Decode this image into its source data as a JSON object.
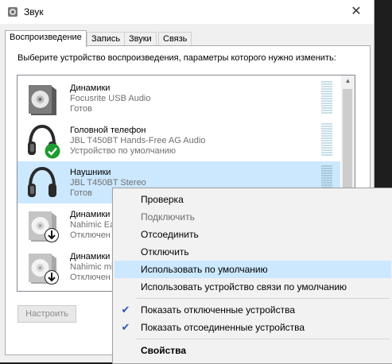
{
  "window": {
    "title": "Звук",
    "close_glyph": "✕"
  },
  "tabs": [
    {
      "label": "Воспроизведение",
      "active": true
    },
    {
      "label": "Запись"
    },
    {
      "label": "Звуки"
    },
    {
      "label": "Связь"
    }
  ],
  "instruction": "Выберите устройство воспроизведения, параметры которого нужно изменить:",
  "devices": [
    {
      "name": "Динамики",
      "driver": "Focusrite USB Audio",
      "status": "Готов",
      "icon": "speaker-icon"
    },
    {
      "name": "Головной телефон",
      "driver": "JBL T450BT Hands-Free AG Audio",
      "status": "Устройство по умолчанию",
      "icon": "headphones-icon",
      "badge": "default-check-icon"
    },
    {
      "name": "Наушники",
      "driver": "JBL T450BT Stereo",
      "status": "Готов",
      "icon": "headphones-icon",
      "selected": true
    },
    {
      "name": "Динамики",
      "driver": "Nahimic Ea",
      "status": "Отключен",
      "icon": "speaker-icon",
      "badge": "disconnected-arrow-icon",
      "dimmed": true
    },
    {
      "name": "Динамики",
      "driver": "Nahimic mi",
      "status": "Отключен",
      "icon": "speaker-icon",
      "badge": "disconnected-arrow-icon",
      "dimmed": true
    }
  ],
  "configure_button": "Настроить",
  "context_menu": {
    "items": [
      {
        "label": "Проверка"
      },
      {
        "label": "Подключить",
        "disabled": true
      },
      {
        "label": "Отсоединить"
      },
      {
        "label": "Отключить"
      },
      {
        "label": "Использовать по умолчанию",
        "highlighted": true
      },
      {
        "label": "Использовать устройство связи по умолчанию"
      },
      {
        "label": "Показать отключенные устройства",
        "checked": true
      },
      {
        "label": "Показать отсоединенные устройства",
        "checked": true
      },
      {
        "label": "Свойства",
        "bold": true
      }
    ],
    "check_glyph": "✔"
  },
  "colors": {
    "selection": "#cce8ff",
    "check": "#2f56b8",
    "default_badge": "#1f9b2f"
  }
}
